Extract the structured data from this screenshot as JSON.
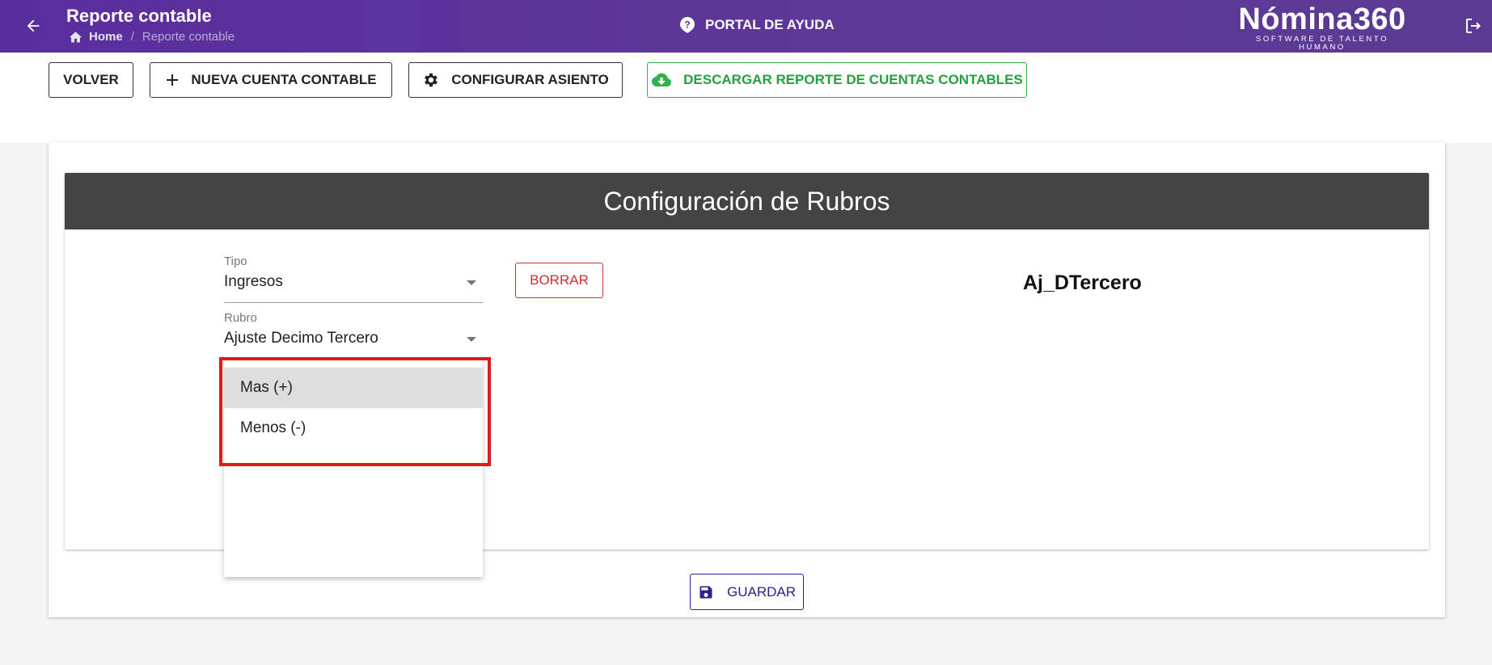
{
  "header": {
    "title": "Reporte contable",
    "breadcrumb": {
      "home": "Home",
      "separator": "/",
      "current": "Reporte contable"
    },
    "help_label": "PORTAL DE AYUDA",
    "logo_main": "Nómina360",
    "logo_sub": "SOFTWARE DE TALENTO HUMANO"
  },
  "toolbar": {
    "volver": "VOLVER",
    "nueva_cuenta": "NUEVA CUENTA CONTABLE",
    "configurar_asiento": "CONFIGURAR ASIENTO",
    "descargar": "DESCARGAR REPORTE DE CUENTAS CONTABLES"
  },
  "card": {
    "title": "Configuración de Rubros",
    "tipo": {
      "label": "Tipo",
      "value": "Ingresos"
    },
    "rubro": {
      "label": "Rubro",
      "value": "Ajuste Decimo Tercero"
    },
    "borrar": "BORRAR",
    "code": "Aj_DTercero"
  },
  "dropdown": {
    "options": [
      "Mas (+)",
      "Menos (-)"
    ],
    "selected_index": 0
  },
  "guardar": "GUARDAR",
  "colors": {
    "topbar": "#5a2d9e",
    "header_bg": "#444444",
    "green": "#2fb34a",
    "red": "#d32f2f",
    "navy": "#2c2288",
    "highlight": "#e0191b"
  }
}
